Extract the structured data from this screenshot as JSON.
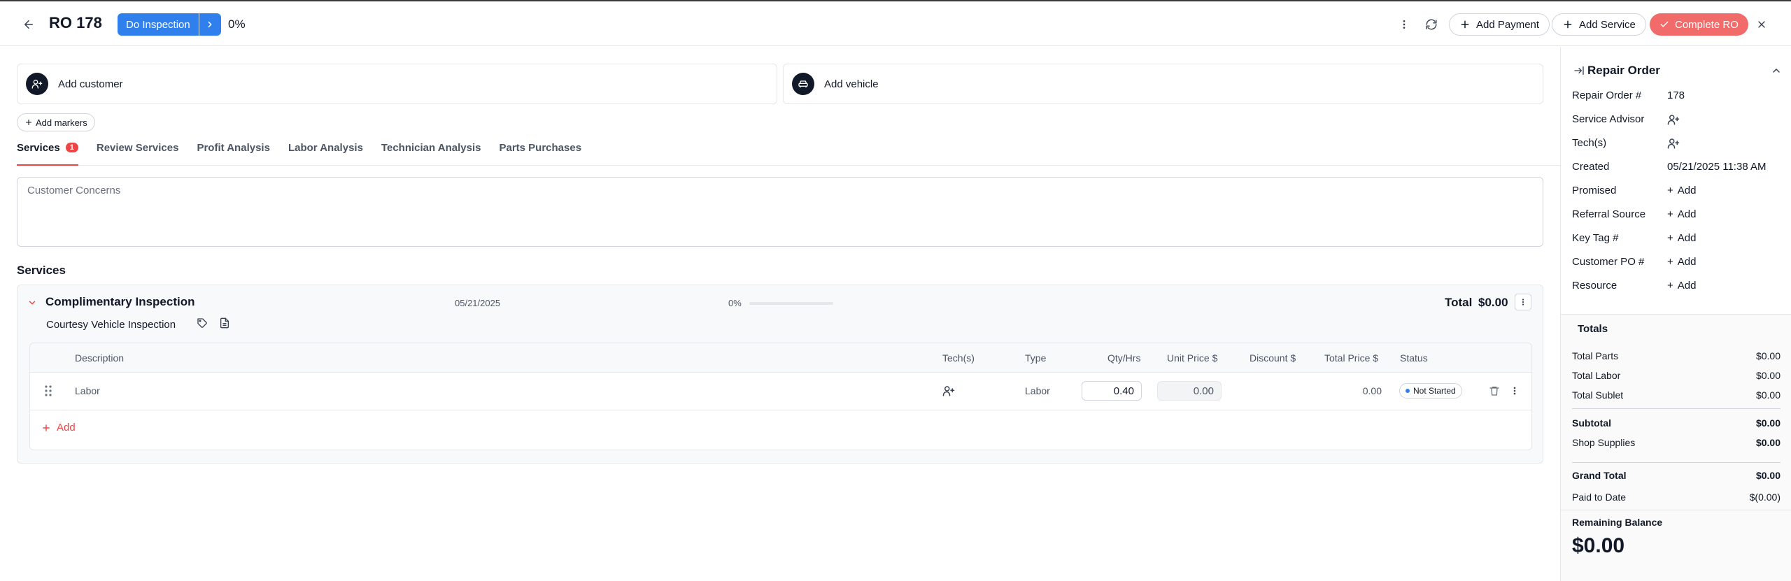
{
  "header": {
    "title": "RO 178",
    "workflow_label": "Do Inspection",
    "progress_text": "0%",
    "add_payment": "Add Payment",
    "add_service": "Add Service",
    "complete": "Complete RO"
  },
  "cards": {
    "customer": "Add customer",
    "vehicle": "Add vehicle"
  },
  "markers_label": "Add markers",
  "tabs": [
    {
      "label": "Services",
      "badge": "1"
    },
    {
      "label": "Review Services"
    },
    {
      "label": "Profit Analysis"
    },
    {
      "label": "Labor Analysis"
    },
    {
      "label": "Technician Analysis"
    },
    {
      "label": "Parts Purchases"
    }
  ],
  "concerns_placeholder": "Customer Concerns",
  "services_title": "Services",
  "service": {
    "name": "Complimentary Inspection",
    "date": "05/21/2025",
    "progress_text": "0%",
    "progress": 0,
    "total_label": "Total",
    "total_value": "$0.00",
    "subtitle": "Courtesy Vehicle Inspection",
    "columns": [
      "Description",
      "Tech(s)",
      "Type",
      "Qty/Hrs",
      "Unit Price $",
      "Discount $",
      "Total Price $",
      "Status"
    ],
    "rows": [
      {
        "description": "Labor",
        "type": "Labor",
        "qty": "0.40",
        "unit_price": "0.00",
        "total_price": "0.00",
        "status": "Not Started"
      }
    ],
    "add_label": "Add"
  },
  "sidebar": {
    "title": "Repair Order",
    "fields": [
      {
        "label": "Repair Order #",
        "value": "178"
      },
      {
        "label": "Service Advisor",
        "value": ""
      },
      {
        "label": "Tech(s)",
        "value": ""
      },
      {
        "label": "Created",
        "value": "05/21/2025 11:38 AM"
      },
      {
        "label": "Promised",
        "value": "Add"
      },
      {
        "label": "Referral Source",
        "value": "Add"
      },
      {
        "label": "Key Tag #",
        "value": "Add"
      },
      {
        "label": "Customer PO #",
        "value": "Add"
      },
      {
        "label": "Resource",
        "value": "Add"
      }
    ],
    "totals_title": "Totals",
    "totals": [
      {
        "label": "Total Parts",
        "value": "$0.00"
      },
      {
        "label": "Total Labor",
        "value": "$0.00"
      },
      {
        "label": "Total Sublet",
        "value": "$0.00"
      },
      {
        "label": "Subtotal",
        "value": "$0.00"
      },
      {
        "label": "Shop Supplies",
        "value": "$0.00"
      },
      {
        "label": "Grand Total",
        "value": "$0.00"
      },
      {
        "label": "Paid to Date",
        "value": "$(0.00)"
      }
    ],
    "remaining_label": "Remaining Balance",
    "remaining_value": "$0.00"
  },
  "colors": {
    "accent_blue": "#2f80ed",
    "danger": "#ef4444",
    "complete_btn": "#f26b6b"
  },
  "icons": [
    "back-arrow-icon",
    "chevron-right-icon",
    "more-vertical-icon",
    "refresh-icon",
    "plus-icon",
    "check-icon",
    "close-icon",
    "user-plus-icon",
    "car-icon",
    "chevron-down-icon",
    "tag-icon",
    "document-icon",
    "drag-handle-icon",
    "trash-icon",
    "collapse-right-icon",
    "chevron-up-icon"
  ]
}
